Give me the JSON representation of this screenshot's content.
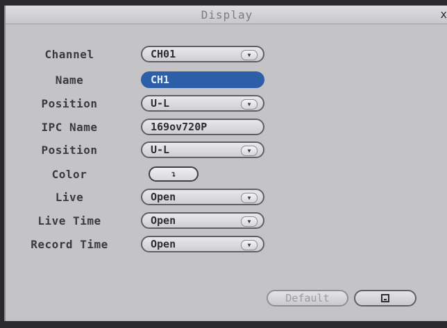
{
  "window": {
    "title": "Display",
    "close_label": "x"
  },
  "rows": [
    {
      "label": "Channel",
      "value": "CH01",
      "has_dropdown": true
    },
    {
      "label": "Name",
      "value": "CH1",
      "selected": true
    },
    {
      "label": "Position",
      "value": "U-L",
      "has_dropdown": true
    },
    {
      "label": "IPC Name",
      "value": "169ov720P"
    },
    {
      "label": "Position",
      "value": "U-L",
      "has_dropdown": true
    },
    {
      "label": "Color",
      "value": "↴"
    },
    {
      "label": "Live",
      "value": "Open",
      "has_dropdown": true
    },
    {
      "label": "Live Time",
      "value": "Open",
      "has_dropdown": true
    },
    {
      "label": "Record Time",
      "value": "Open",
      "has_dropdown": true
    }
  ],
  "dropdown_icon": "chevron-down-icon",
  "buttons": {
    "default_label": "Default",
    "save_icon": "save-icon"
  },
  "colors": {
    "selected_field": "#2c5fa8",
    "panel": "#c4c4c6",
    "frame": "#2a2a2c"
  }
}
